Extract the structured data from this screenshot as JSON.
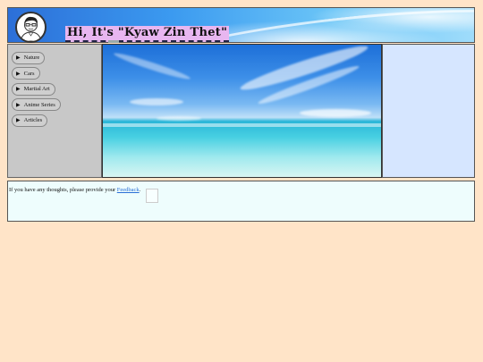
{
  "header": {
    "greeting": "Hi, It's \"Kyaw Zin Thet\"",
    "avatar_icon": "avatar-sketch-icon"
  },
  "sidebar": {
    "items": [
      {
        "label": "Nature"
      },
      {
        "label": "Cars"
      },
      {
        "label": "Martial Art"
      },
      {
        "label": "Anime Series"
      },
      {
        "label": "Articles"
      }
    ],
    "expand_icon": "triangle-right-icon"
  },
  "hero": {
    "image": "beach-ocean-photo"
  },
  "footer": {
    "text": "If you have any thoughts, please provide your ",
    "link": "Feedback",
    "suffix": "."
  },
  "colors": {
    "page_bg": "#ffe4c8",
    "sidebar_bg": "#c8c8c8",
    "right_panel_bg": "#d6e6ff",
    "footer_bg": "#eefdfd",
    "greeting_bg": "#e8b6f0",
    "link": "#2a6fd6"
  }
}
